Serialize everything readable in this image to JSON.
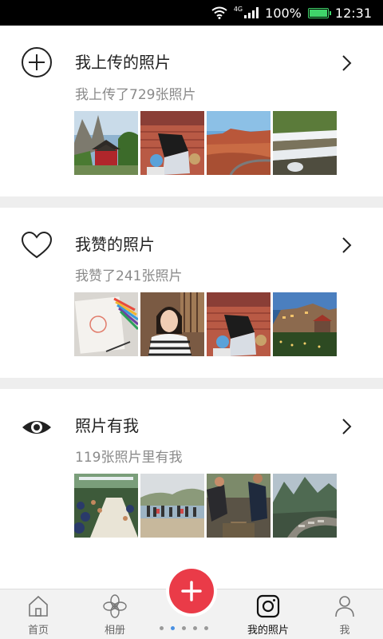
{
  "status_bar": {
    "network": "4G",
    "battery": "100%",
    "time": "12:31"
  },
  "sections": [
    {
      "icon": "plus-circle-icon",
      "title": "我上传的照片",
      "subtitle": "我上传了729张照片",
      "thumbnails": [
        "chinese-pavilion-photo",
        "graffiti-wall-photo",
        "red-canyon-photo",
        "waterfall-photo"
      ]
    },
    {
      "icon": "heart-icon",
      "title": "我赞的照片",
      "subtitle": "我赞了241张照片",
      "thumbnails": [
        "sketch-notebook-photo",
        "girl-portrait-photo",
        "graffiti-wall-photo",
        "night-resort-photo"
      ]
    },
    {
      "icon": "eye-icon",
      "title": "照片有我",
      "subtitle": "119张照片里有我",
      "thumbnails": [
        "banquet-hall-photo",
        "beach-group-photo",
        "outdoor-people-photo",
        "mountain-stream-photo"
      ]
    }
  ],
  "bottom_nav": {
    "items": [
      {
        "label": "首页",
        "icon": "home-icon"
      },
      {
        "label": "相册",
        "icon": "flower-icon"
      },
      {
        "label": "我的照片",
        "icon": "instagram-camera-icon",
        "active": true
      },
      {
        "label": "我",
        "icon": "person-icon"
      }
    ],
    "fab_icon": "plus-icon",
    "page_dots": 5,
    "active_dot": 1
  },
  "colors": {
    "accent": "#ea3b48",
    "divider": "#eeeeee",
    "subtitle": "#8a8a8a",
    "battery": "#3fd46a"
  }
}
